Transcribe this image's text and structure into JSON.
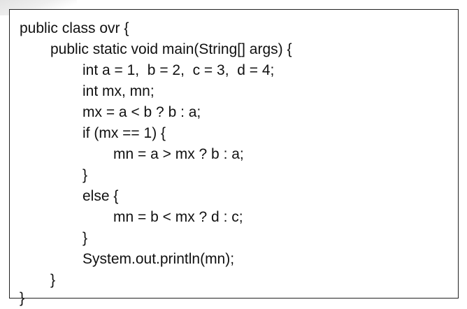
{
  "code": {
    "lines": [
      "public class ovr {",
      "public static void main(String[] args) {",
      "int a = 1,  b = 2,  c = 3,  d = 4;",
      "int mx, mn;",
      "mx = a < b ? b : a;",
      "if (mx == 1) {",
      "mn = a > mx ? b : a;",
      "}",
      "else {",
      "mn = b < mx ? d : c;",
      "}",
      "System.out.println(mn);",
      "}",
      "}"
    ]
  }
}
